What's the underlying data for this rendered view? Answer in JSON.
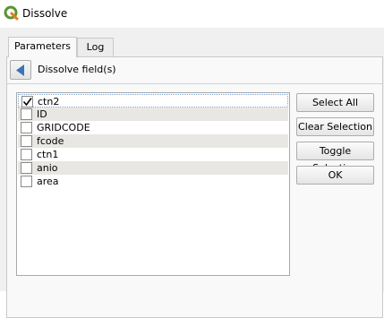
{
  "window": {
    "title": "Dissolve",
    "icon": "qgis-logo-icon",
    "accent": "#589632"
  },
  "tabs": [
    {
      "label": "Parameters",
      "active": true
    },
    {
      "label": "Log",
      "active": false
    }
  ],
  "panel": {
    "back_icon": "back-arrow-icon",
    "header_label": "Dissolve field(s)"
  },
  "fields": [
    {
      "label": "ctn2",
      "checked": true
    },
    {
      "label": "ID",
      "checked": false
    },
    {
      "label": "GRIDCODE",
      "checked": false
    },
    {
      "label": "fcode",
      "checked": false
    },
    {
      "label": "ctn1",
      "checked": false
    },
    {
      "label": "anio",
      "checked": false
    },
    {
      "label": "area",
      "checked": false
    }
  ],
  "buttons": {
    "select_all": "Select All",
    "clear_selection": "Clear Selection",
    "toggle_selection": "Toggle Selection",
    "ok": "OK"
  }
}
